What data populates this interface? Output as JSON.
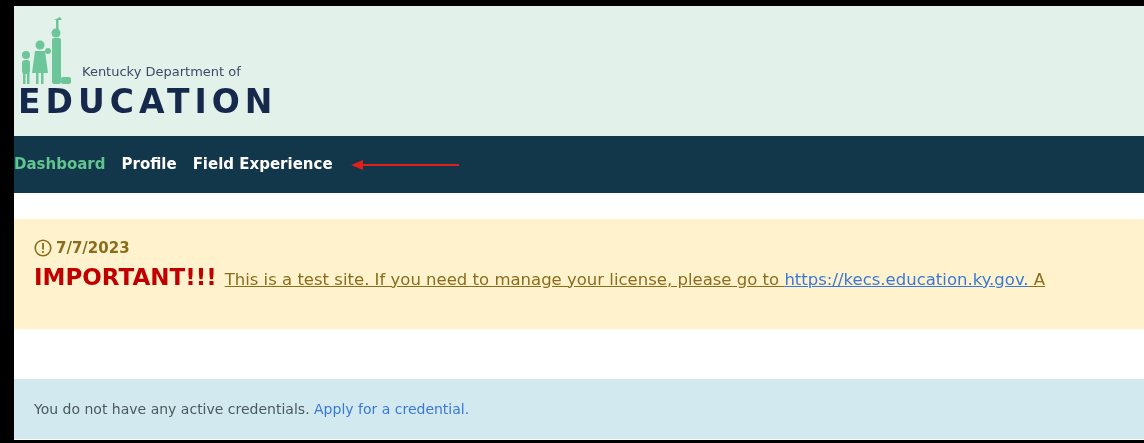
{
  "header": {
    "logo_subtitle": "Kentucky Department of",
    "logo_title": "EDUCATION"
  },
  "nav": {
    "items": [
      {
        "label": "Dashboard",
        "selected": true
      },
      {
        "label": "Profile",
        "selected": false
      },
      {
        "label": "Field Experience",
        "selected": false
      }
    ]
  },
  "alert": {
    "date": "7/7/2023",
    "heading": "IMPORTANT!!!",
    "message_before": "This is a test site. If you need to manage your license, please go to ",
    "link": "https://kecs.education.ky.gov.",
    "message_after": " A"
  },
  "info": {
    "text": "You do not have any active credentials.",
    "link": "Apply for a credential."
  }
}
